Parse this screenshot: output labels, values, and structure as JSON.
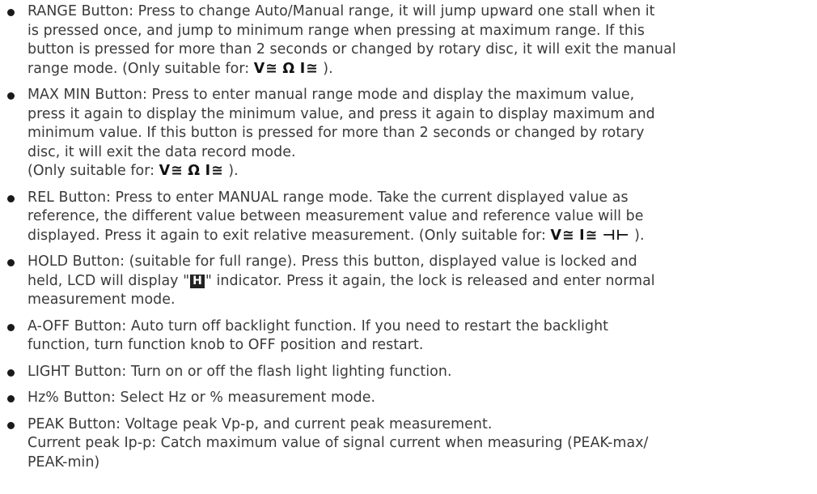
{
  "symbols": {
    "volt": "V≅",
    "ohm": "Ω",
    "amp": "I≅",
    "cap": "⊣⊢",
    "hold": "H"
  },
  "items": [
    {
      "lines": [
        "RANGE Button: Press to change Auto/Manual range, it will jump upward one stall when it",
        "is pressed once, and jump to minimum range when pressing at maximum range. If this",
        "button is pressed for more than 2 seconds or changed by rotary disc, it will exit the manual"
      ],
      "last_prefix": "range mode. (Only suitable for: ",
      "last_suffix": " )."
    },
    {
      "lines": [
        "MAX MIN Button: Press to enter manual range mode and display the maximum value,",
        "press it again to display the minimum value, and press it again to display maximum and",
        "minimum value. If this button is pressed for more than 2 seconds or changed by rotary",
        "disc, it will exit the data record mode."
      ],
      "last_prefix": "(Only suitable for: ",
      "last_suffix": " )."
    },
    {
      "lines": [
        "REL Button: Press to enter MANUAL range mode. Take the current displayed value as",
        "reference, the different value between measurement value and reference value will be"
      ],
      "last_prefix": "displayed. Press it again to exit relative measurement. (Only suitable for: ",
      "last_suffix": " )."
    },
    {
      "line1": "HOLD Button: (suitable for full range). Press this button, displayed value is locked and",
      "line2_prefix": "held, LCD will display \"",
      "line2_suffix": "\" indicator. Press it again, the lock is released and enter normal",
      "line3": "measurement mode."
    },
    {
      "lines": [
        "A-OFF Button: Auto turn off backlight function. If you need to restart the backlight",
        "function, turn function knob to OFF position and restart."
      ]
    },
    {
      "lines": [
        "LIGHT Button: Turn on or off the flash light lighting function."
      ]
    },
    {
      "lines": [
        "Hz% Button: Select Hz or % measurement mode."
      ]
    },
    {
      "lines": [
        "PEAK Button: Voltage peak Vp-p, and current peak measurement.",
        "Current peak Ip-p: Catch maximum value of signal current when measuring (PEAK-max/",
        "PEAK-min)"
      ]
    }
  ]
}
